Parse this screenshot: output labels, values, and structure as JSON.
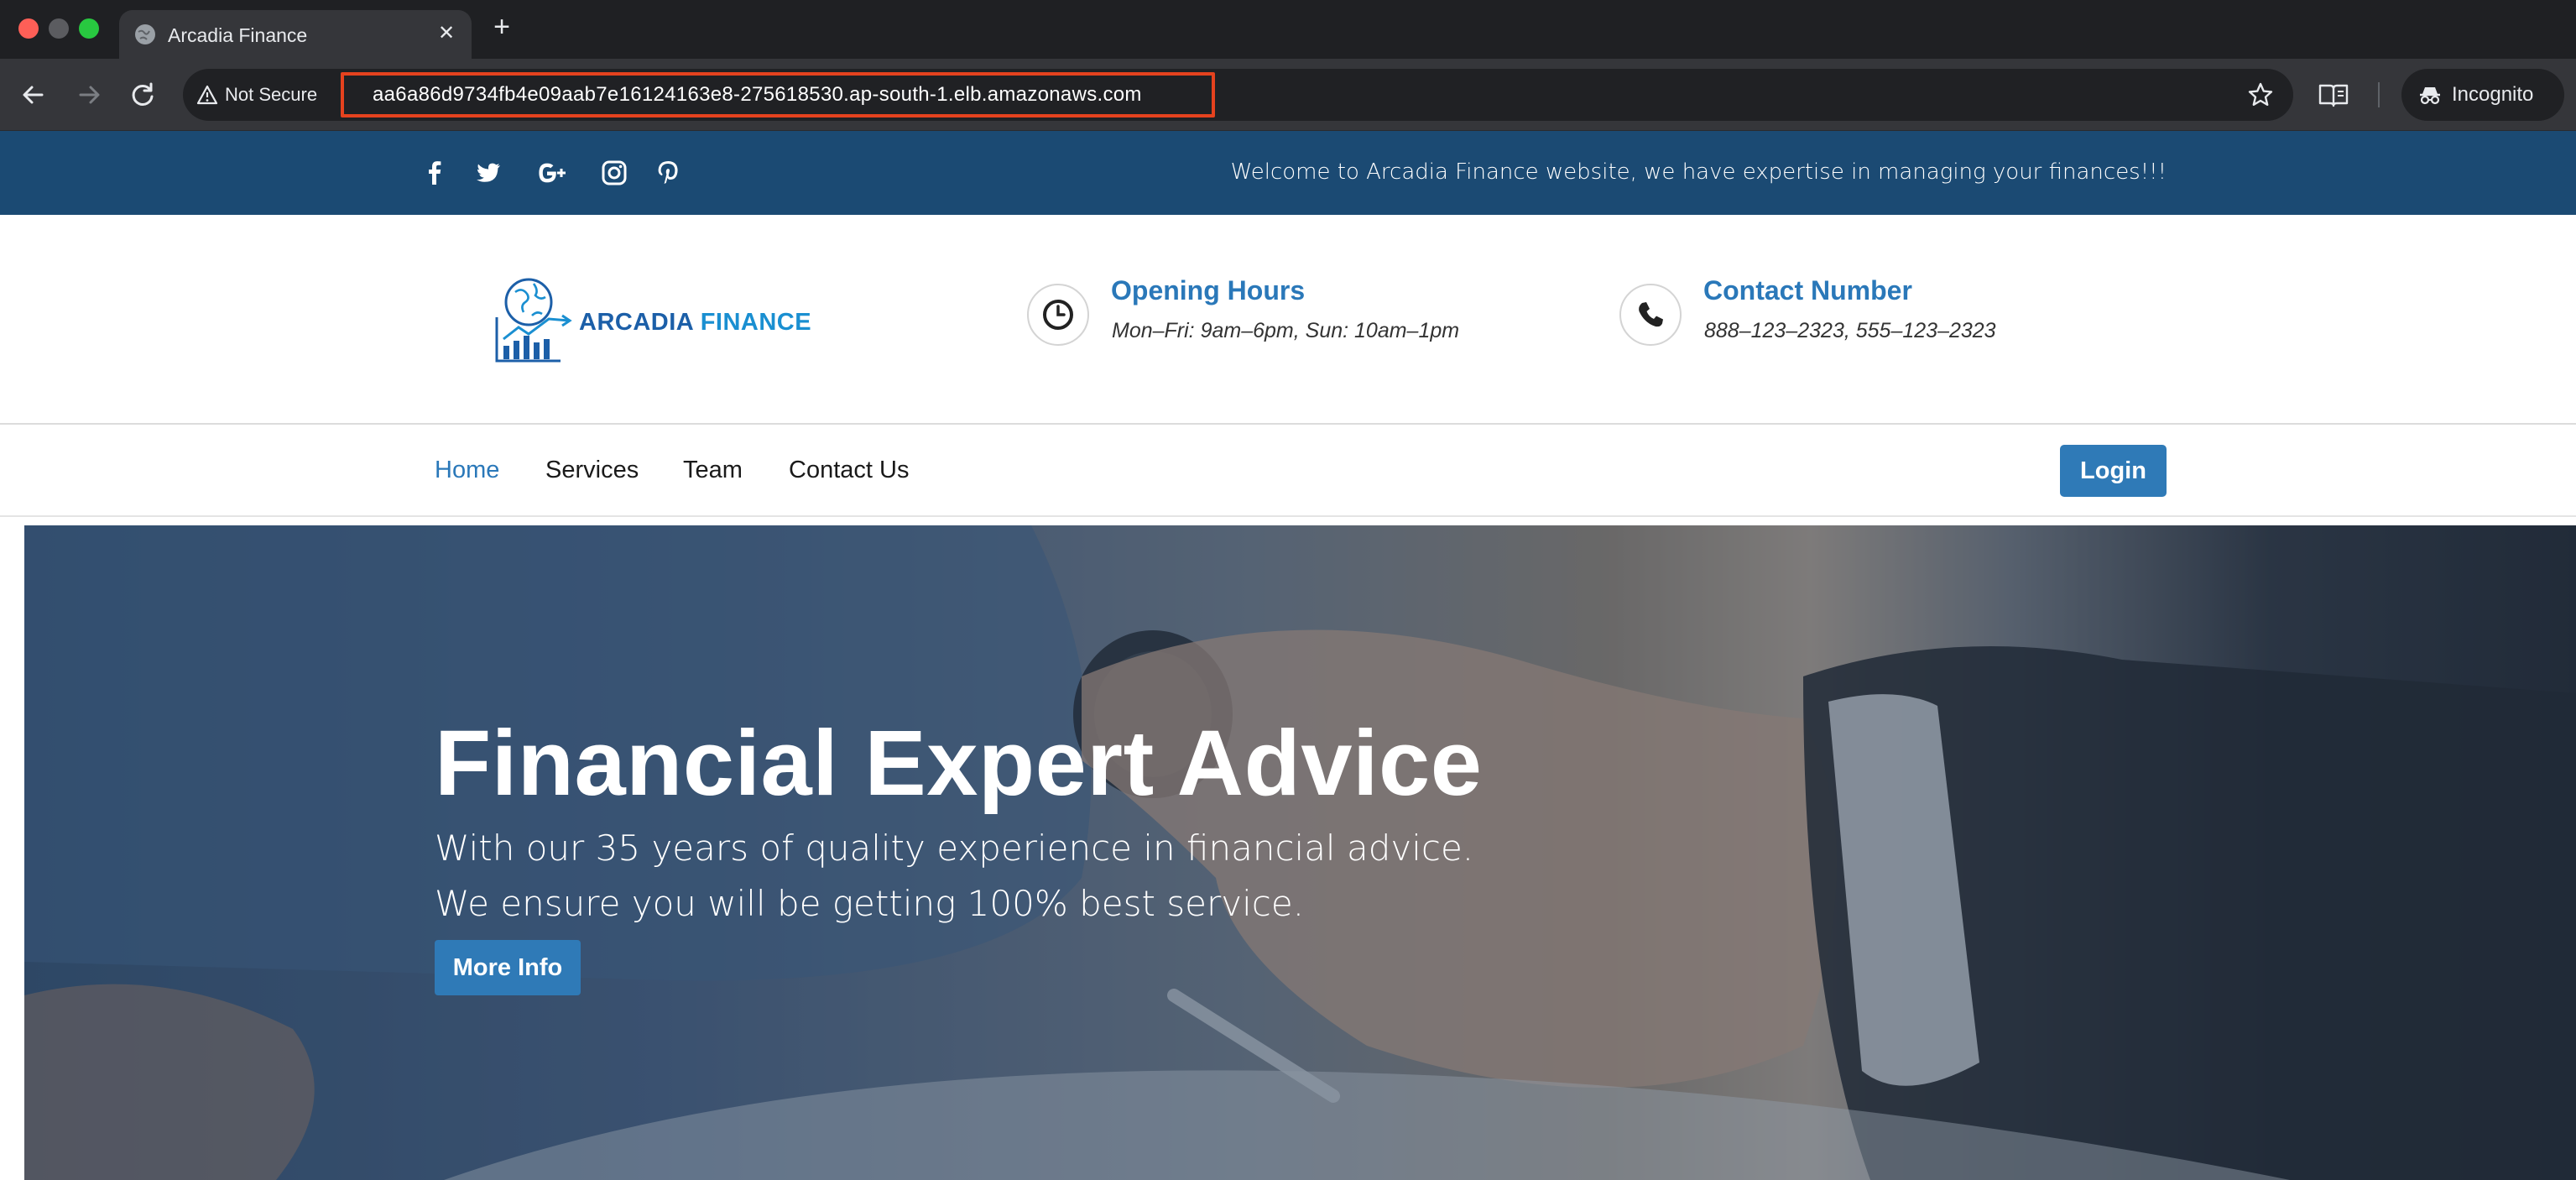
{
  "browser": {
    "tab_title": "Arcadia Finance",
    "new_tab_label": "+",
    "security_label": "Not Secure",
    "url": "aa6a86d9734fb4e09aab7e16124163e8-275618530.ap-south-1.elb.amazonaws.com",
    "incognito_label": "Incognito",
    "colors": {
      "frame": "#1f2023",
      "toolbar": "#35363a",
      "omnibox": "#202124",
      "url_highlight": "#e5421e"
    },
    "icons": [
      "close-icon",
      "back-icon",
      "forward-icon",
      "reload-icon",
      "warning-icon",
      "star-icon",
      "reading-mode-icon",
      "incognito-icon"
    ]
  },
  "topbar": {
    "social": [
      "facebook-icon",
      "twitter-icon",
      "google-plus-icon",
      "instagram-icon",
      "pinterest-icon"
    ],
    "welcome": "Welcome to Arcadia Finance website, we have expertise in managing your finances!!!",
    "background": "#1b4a73"
  },
  "header": {
    "logo_text_1": "ARCADIA",
    "logo_text_2": "FINANCE",
    "opening": {
      "title": "Opening Hours",
      "value": "Mon–Fri: 9am–6pm, Sun: 10am–1pm",
      "icon": "clock-icon"
    },
    "contact": {
      "title": "Contact Number",
      "value": "888–123–2323, 555–123–2323",
      "icon": "phone-icon"
    },
    "accent": "#2a78b9"
  },
  "nav": {
    "items": [
      {
        "label": "Home",
        "active": true
      },
      {
        "label": "Services",
        "active": false
      },
      {
        "label": "Team",
        "active": false
      },
      {
        "label": "Contact Us",
        "active": false
      }
    ],
    "login_label": "Login"
  },
  "hero": {
    "title": "Financial Expert Advice",
    "line1": "With our 35 years of quality experience in financial advice.",
    "line2": "We ensure you will be getting 100% best service.",
    "button_label": "More Info",
    "button_color": "#2f7ab7"
  }
}
